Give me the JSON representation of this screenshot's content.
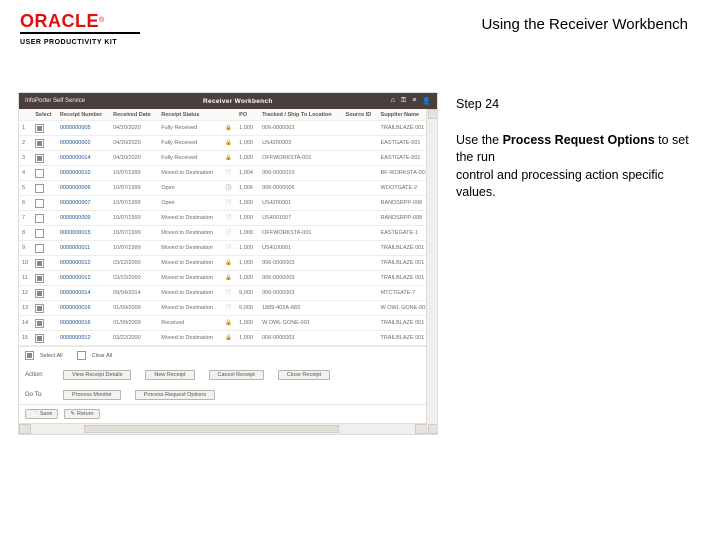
{
  "header": {
    "brand": "ORACLE",
    "tm": "®",
    "upk": "USER PRODUCTIVITY KIT",
    "doc_title": "Using the Receiver Workbench"
  },
  "sidebar": {
    "step": "Step 24",
    "body_1": "Use the ",
    "body_emph": "Process Request Options",
    "body_2": " to set the run",
    "body_3": "control and processing action specific values."
  },
  "app": {
    "topbar_left": "InfoPorter Self Service",
    "topbar_title": "Receiver Workbench",
    "icons": {
      "home": "⌂",
      "key": "⚿",
      "menu": "≡",
      "user": "👤"
    },
    "columns": [
      "",
      "Select",
      "Receipt Number",
      "Received Date",
      "Receipt Status",
      "",
      "PO",
      "Tracked / Ship To Location",
      "Source ID",
      "Supplier Name"
    ],
    "rows": [
      {
        "n": "1",
        "cb": true,
        "rec": "0000000005",
        "date": "04/20/2020",
        "status": "Fully Received",
        "sec": "🔒",
        "po": "1,000",
        "ship": "006-0000003",
        "src": "",
        "sup": "TRAILBLAZE 001"
      },
      {
        "n": "2",
        "cb": true,
        "rec": "0000000002",
        "date": "04/20/2020",
        "status": "Fully Received",
        "sec": "🔒",
        "po": "1,000",
        "ship": "US4200003",
        "src": "",
        "sup": "EASTGATE-001"
      },
      {
        "n": "3",
        "cb": true,
        "rec": "0000000014",
        "date": "04/20/2020",
        "status": "Fully Received",
        "sec": "🔒",
        "po": "1,000",
        "ship": "OFFWORKSTA-001",
        "src": "",
        "sup": "EASTGATE-001"
      },
      {
        "n": "4",
        "cb": false,
        "rec": "0000000010",
        "date": "10/07/1999",
        "status": "Moved to Destination",
        "sec": "📄",
        "po": "1,004",
        "ship": "006-0000010",
        "src": "",
        "sup": "BF-WORKSTA-001"
      },
      {
        "n": "5",
        "cb": false,
        "rec": "0000000006",
        "date": "10/07/1999",
        "status": "Open",
        "sec": "🕓",
        "po": "1,006",
        "ship": "006-0000006",
        "src": "",
        "sup": "WOOTGATE-2"
      },
      {
        "n": "6",
        "cb": false,
        "rec": "0000000007",
        "date": "10/07/1999",
        "status": "Open",
        "sec": "📄",
        "po": "1,000",
        "ship": "US4200001",
        "src": "",
        "sup": "RANDSRPP-008"
      },
      {
        "n": "7",
        "cb": false,
        "rec": "0000000009",
        "date": "10/07/1999",
        "status": "Moved to Destination",
        "sec": "📄",
        "po": "1,000",
        "ship": "US4001007",
        "src": "",
        "sup": "RANDSRPP-008"
      },
      {
        "n": "8",
        "cb": false,
        "rec": "0000000015",
        "date": "10/07/1999",
        "status": "Moved to Destination",
        "sec": "📄",
        "po": "1,000",
        "ship": "OFFWORKSTA-001",
        "src": "",
        "sup": "EASTEGATE-1"
      },
      {
        "n": "9",
        "cb": false,
        "rec": "0000000011",
        "date": "10/07/1999",
        "status": "Moved to Destination",
        "sec": "📄",
        "po": "1,000",
        "ship": "US4100001",
        "src": "",
        "sup": "TRAILBLAZE 001"
      },
      {
        "n": "10",
        "cb": true,
        "rec": "0000000012",
        "date": "03/22/2000",
        "status": "Moved to Destination",
        "sec": "🔒",
        "po": "1,000",
        "ship": "006-0000003",
        "src": "",
        "sup": "TRAILBLAZE 001"
      },
      {
        "n": "11",
        "cb": true,
        "rec": "0000000012",
        "date": "03/22/2000",
        "status": "Moved to Destination",
        "sec": "🔒",
        "po": "1,000",
        "ship": "006-0000003",
        "src": "",
        "sup": "TRAILBLAZE 001"
      },
      {
        "n": "12",
        "cb": true,
        "rec": "0000000014",
        "date": "09/04/2014",
        "status": "Moved to Destination",
        "sec": "📄",
        "po": "5,000",
        "ship": "006-0000003",
        "src": "",
        "sup": "MTCTGATE-7"
      },
      {
        "n": "13",
        "cb": true,
        "rec": "0000000016",
        "date": "01/09/2009",
        "status": "Moved to Destination",
        "sec": "📄",
        "po": "5,000",
        "ship": "1889-402A-683",
        "src": "",
        "sup": "W OWL GONE-001"
      },
      {
        "n": "14",
        "cb": true,
        "rec": "0000000016",
        "date": "01/09/2009",
        "status": "Received",
        "sec": "🔒",
        "po": "1,000",
        "ship": "W OWL GONE-001",
        "src": "",
        "sup": "TRAILBLAZE 001"
      },
      {
        "n": "15",
        "cb": true,
        "rec": "0000000012",
        "date": "03/22/2000",
        "status": "Moved to Destination",
        "sec": "🔒",
        "po": "1,000",
        "ship": "006-0000003",
        "src": "",
        "sup": "TRAILBLAZE 001"
      }
    ],
    "select_all": "Select All",
    "clear_all": "Clear All",
    "action_label": "Action:",
    "goto_label": "Go To:",
    "actions": {
      "view_details": "View Receipt Details",
      "new_receipt": "New Receipt",
      "cancel_receipt": "Cancel Receipt",
      "close_receipt": "Close Receipt"
    },
    "gotos": {
      "process_monitor": "Process Monitor",
      "process_request": "Process Request Options"
    },
    "bottom_buttons": {
      "save": "Save",
      "return": "Return"
    },
    "save_icon": "📄",
    "return_icon": "✎",
    "sel_all_cb": true,
    "clear_all_cb": false
  }
}
